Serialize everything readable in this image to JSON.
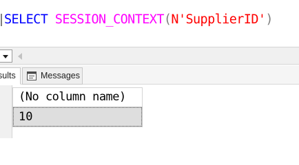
{
  "editor": {
    "query_tokens": [
      {
        "text": "SELECT",
        "kind": "keyword"
      },
      {
        "text": " ",
        "kind": "space"
      },
      {
        "text": "SESSION_CONTEXT",
        "kind": "function"
      },
      {
        "text": "(",
        "kind": "operator"
      },
      {
        "text": "N'SupplierID'",
        "kind": "string"
      },
      {
        "text": ")",
        "kind": "operator"
      }
    ]
  },
  "results_tabs": {
    "results_label": "sults",
    "messages_label": "Messages"
  },
  "grid": {
    "columns": [
      "(No column name)"
    ],
    "rows": [
      [
        "10"
      ]
    ]
  },
  "colors": {
    "keyword": "#0000ff",
    "function": "#ff00ff",
    "operator": "#808080",
    "string": "#ff0000",
    "selected_cell": "#dedede"
  }
}
